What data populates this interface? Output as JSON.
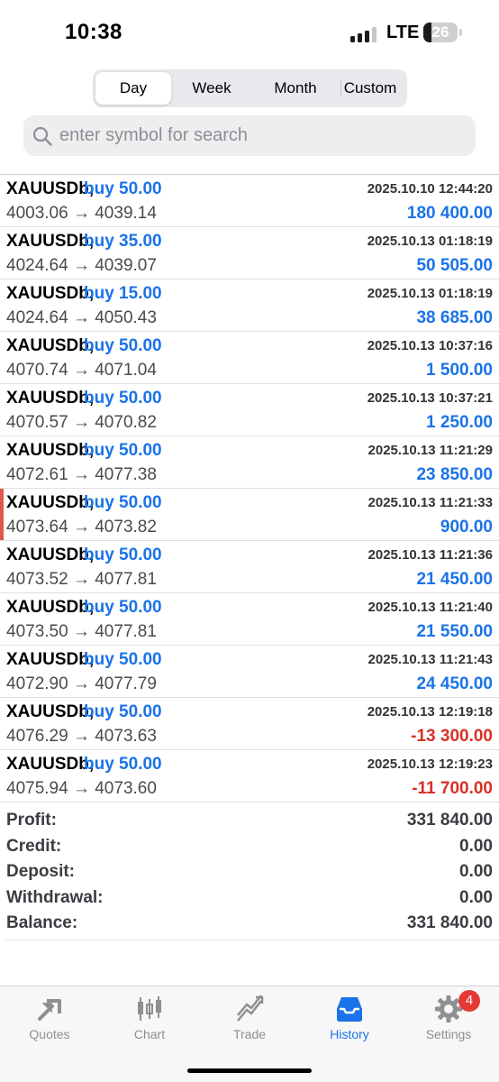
{
  "status_bar": {
    "time": "10:38",
    "network": "LTE",
    "battery": "26"
  },
  "period_tabs": [
    {
      "label": "Day",
      "selected": true
    },
    {
      "label": "Week",
      "selected": false
    },
    {
      "label": "Month",
      "selected": false
    },
    {
      "label": "Custom",
      "selected": false
    }
  ],
  "search": {
    "placeholder": "enter symbol for search",
    "value": ""
  },
  "trades": [
    {
      "symbol": "XAUUSDb,",
      "side": "buy 50.00",
      "time": "2025.10.10 12:44:20",
      "prices": "4003.06 → 4039.14",
      "profit": "180 400.00",
      "positive": true,
      "marked": false
    },
    {
      "symbol": "XAUUSDb,",
      "side": "buy 35.00",
      "time": "2025.10.13 01:18:19",
      "prices": "4024.64 → 4039.07",
      "profit": "50 505.00",
      "positive": true,
      "marked": false
    },
    {
      "symbol": "XAUUSDb,",
      "side": "buy 15.00",
      "time": "2025.10.13 01:18:19",
      "prices": "4024.64 → 4050.43",
      "profit": "38 685.00",
      "positive": true,
      "marked": false
    },
    {
      "symbol": "XAUUSDb,",
      "side": "buy 50.00",
      "time": "2025.10.13 10:37:16",
      "prices": "4070.74 → 4071.04",
      "profit": "1 500.00",
      "positive": true,
      "marked": false
    },
    {
      "symbol": "XAUUSDb,",
      "side": "buy 50.00",
      "time": "2025.10.13 10:37:21",
      "prices": "4070.57 → 4070.82",
      "profit": "1 250.00",
      "positive": true,
      "marked": false
    },
    {
      "symbol": "XAUUSDb,",
      "side": "buy 50.00",
      "time": "2025.10.13 11:21:29",
      "prices": "4072.61 → 4077.38",
      "profit": "23 850.00",
      "positive": true,
      "marked": false
    },
    {
      "symbol": "XAUUSDb,",
      "side": "buy 50.00",
      "time": "2025.10.13 11:21:33",
      "prices": "4073.64 → 4073.82",
      "profit": "900.00",
      "positive": true,
      "marked": true
    },
    {
      "symbol": "XAUUSDb,",
      "side": "buy 50.00",
      "time": "2025.10.13 11:21:36",
      "prices": "4073.52 → 4077.81",
      "profit": "21 450.00",
      "positive": true,
      "marked": false
    },
    {
      "symbol": "XAUUSDb,",
      "side": "buy 50.00",
      "time": "2025.10.13 11:21:40",
      "prices": "4073.50 → 4077.81",
      "profit": "21 550.00",
      "positive": true,
      "marked": false
    },
    {
      "symbol": "XAUUSDb,",
      "side": "buy 50.00",
      "time": "2025.10.13 11:21:43",
      "prices": "4072.90 → 4077.79",
      "profit": "24 450.00",
      "positive": true,
      "marked": false
    },
    {
      "symbol": "XAUUSDb,",
      "side": "buy 50.00",
      "time": "2025.10.13 12:19:18",
      "prices": "4076.29 → 4073.63",
      "profit": "-13 300.00",
      "positive": false,
      "marked": false
    },
    {
      "symbol": "XAUUSDb,",
      "side": "buy 50.00",
      "time": "2025.10.13 12:19:23",
      "prices": "4075.94 → 4073.60",
      "profit": "-11 700.00",
      "positive": false,
      "marked": false
    }
  ],
  "summary": [
    {
      "label": "Profit:",
      "value": "331 840.00"
    },
    {
      "label": "Credit:",
      "value": "0.00"
    },
    {
      "label": "Deposit:",
      "value": "0.00"
    },
    {
      "label": "Withdrawal:",
      "value": "0.00"
    },
    {
      "label": "Balance:",
      "value": "331 840.00"
    }
  ],
  "tab_bar": [
    {
      "label": "Quotes",
      "icon": "quotes-icon",
      "active": false
    },
    {
      "label": "Chart",
      "icon": "chart-icon",
      "active": false
    },
    {
      "label": "Trade",
      "icon": "trade-icon",
      "active": false
    },
    {
      "label": "History",
      "icon": "history-icon",
      "active": true
    },
    {
      "label": "Settings",
      "icon": "settings-icon",
      "active": false,
      "badge": "4"
    }
  ],
  "colors": {
    "accent": "#1a73e8",
    "negative": "#d93025",
    "marker": "#e2574c",
    "badge": "#e53935"
  }
}
